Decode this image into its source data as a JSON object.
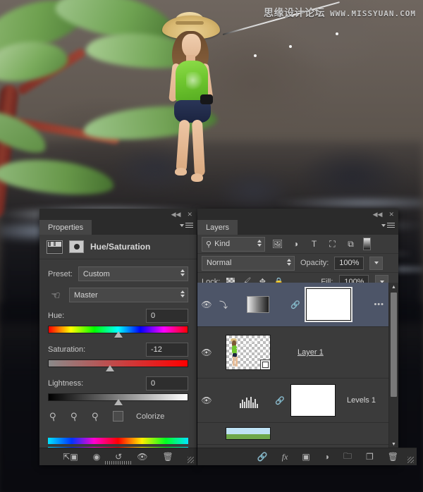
{
  "watermark": {
    "chinese": "思缘设计论坛",
    "url": "WWW.MISSYUAN.COM"
  },
  "properties_panel": {
    "tab_label": "Properties",
    "collapse_icon": "◀◀",
    "close_icon": "✕",
    "adjustment_icon": "hue-saturation-icon",
    "mask_icon": "layer-mask-icon",
    "title": "Hue/Saturation",
    "preset_label": "Preset:",
    "preset_value": "Custom",
    "channel_value": "Master",
    "hand_icon": "on-image-adjust-hand-icon",
    "sliders": [
      {
        "label": "Hue:",
        "value": "0",
        "thumb_pct": 50
      },
      {
        "label": "Saturation:",
        "value": "-12",
        "thumb_pct": 44
      },
      {
        "label": "Lightness:",
        "value": "0",
        "thumb_pct": 50
      }
    ],
    "eyedroppers": [
      "eyedropper-icon",
      "eyedropper-plus-icon",
      "eyedropper-minus-icon"
    ],
    "colorize_label": "Colorize",
    "colorize_checked": false,
    "footer_icons": [
      "clip-to-layer-icon",
      "view-previous-state-icon",
      "reset-icon",
      "toggle-visibility-icon",
      "delete-icon"
    ]
  },
  "layers_panel": {
    "tab_label": "Layers",
    "collapse_icon": "◀◀",
    "close_icon": "✕",
    "filter_kind_label": "Kind",
    "search_icon": "search-icon",
    "filter_icons": [
      "pixel-layer-filter-icon",
      "adjustment-layer-filter-icon",
      "type-layer-filter-icon",
      "shape-layer-filter-icon",
      "smart-object-filter-icon"
    ],
    "filter_toggle_icon": "filter-enable-toggle-icon",
    "blend_mode": "Normal",
    "opacity_label": "Opacity:",
    "opacity_value": "100%",
    "lock_label": "Lock:",
    "lock_icons": [
      "lock-transparency-icon",
      "lock-image-pixels-icon",
      "lock-position-icon",
      "lock-all-icon"
    ],
    "fill_label": "Fill:",
    "fill_value": "100%",
    "rows": [
      {
        "name": "",
        "selected": true,
        "eye_icon": "eye-icon",
        "clip_icon": "clipping-mask-icon",
        "thumb_type": "hue-saturation-thumbnail",
        "link_icon": "link-mask-icon",
        "has_mask": true,
        "overflow_icon": "•••"
      },
      {
        "name": "Layer 1",
        "selected": false,
        "eye_icon": "eye-icon",
        "thumb_type": "pixel-thumbnail",
        "badge": "smart-object-badge",
        "has_mask": false
      },
      {
        "name": "Levels 1",
        "selected": false,
        "eye_icon": "eye-icon",
        "thumb_type": "levels-thumbnail",
        "link_icon": "link-mask-icon",
        "has_mask": true
      },
      {
        "name": "",
        "selected": false,
        "thumb_type": "background-thumbnail",
        "has_mask": false
      }
    ],
    "scroll_up_icon": "▲",
    "scroll_down_icon": "▼",
    "footer_icons": [
      "link-layers-icon",
      "fx-icon",
      "add-mask-icon",
      "new-adjustment-icon",
      "new-group-icon",
      "new-layer-icon",
      "delete-layer-icon"
    ]
  },
  "colors": {
    "panel_bg": "#3b3b3b",
    "panel_header": "#2b2b2b",
    "selected_row": "#4d5568",
    "text": "#d5d5d5"
  }
}
